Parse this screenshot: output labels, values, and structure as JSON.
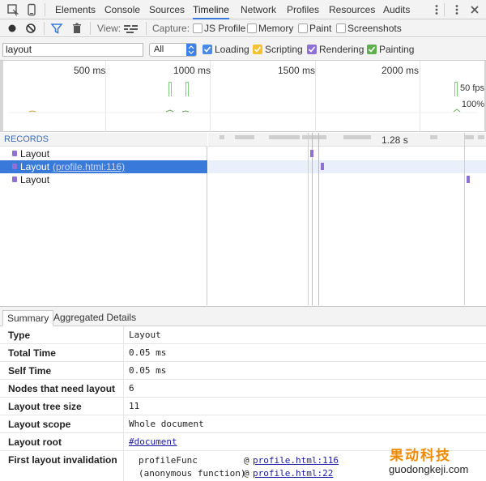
{
  "tabs": [
    {
      "label": "Elements"
    },
    {
      "label": "Console"
    },
    {
      "label": "Sources"
    },
    {
      "label": "Timeline"
    },
    {
      "label": "Network"
    },
    {
      "label": "Profiles"
    },
    {
      "label": "Resources"
    },
    {
      "label": "Audits"
    }
  ],
  "selected_tab": "Timeline",
  "toolbar": {
    "view_label": "View:",
    "capture_label": "Capture:",
    "capture_options": [
      {
        "label": "JS Profile",
        "checked": false
      },
      {
        "label": "Memory",
        "checked": false
      },
      {
        "label": "Paint",
        "checked": false
      },
      {
        "label": "Screenshots",
        "checked": false
      }
    ]
  },
  "filter": {
    "value": "layout",
    "select_value": "All",
    "categories": [
      {
        "label": "Loading",
        "color": "#4a8ae6"
      },
      {
        "label": "Scripting",
        "color": "#f2c230"
      },
      {
        "label": "Rendering",
        "color": "#8f70d4"
      },
      {
        "label": "Painting",
        "color": "#5fae4f"
      }
    ]
  },
  "overview": {
    "ticks": [
      "500 ms",
      "1000 ms",
      "1500 ms",
      "2000 ms"
    ],
    "fps_label": "50 fps",
    "percent_label": "100%"
  },
  "records": {
    "header": "RECORDS",
    "items": [
      {
        "label": "Layout",
        "link": ""
      },
      {
        "label": "Layout",
        "link": "(profile.html:116)"
      },
      {
        "label": "Layout",
        "link": ""
      }
    ],
    "duration_label": "1.28 s"
  },
  "details": {
    "tabs": [
      "Summary",
      "Aggregated Details"
    ],
    "rows": [
      {
        "key": "Type",
        "value": "Layout"
      },
      {
        "key": "Total Time",
        "value": "0.05 ms"
      },
      {
        "key": "Self Time",
        "value": "0.05 ms"
      },
      {
        "key": "Nodes that need layout",
        "value": "6"
      },
      {
        "key": "Layout tree size",
        "value": "11"
      },
      {
        "key": "Layout scope",
        "value": "Whole document"
      },
      {
        "key": "Layout root",
        "value": "#document"
      }
    ],
    "invalidation_key": "First layout invalidation",
    "stack": [
      {
        "func": "profileFunc",
        "at": "@",
        "link": "profile.html:116"
      },
      {
        "func": "(anonymous function)",
        "at": "@",
        "link": "profile.html:22"
      }
    ]
  },
  "watermark": {
    "cn": "果动科技",
    "en": "guodongkeji.com"
  }
}
